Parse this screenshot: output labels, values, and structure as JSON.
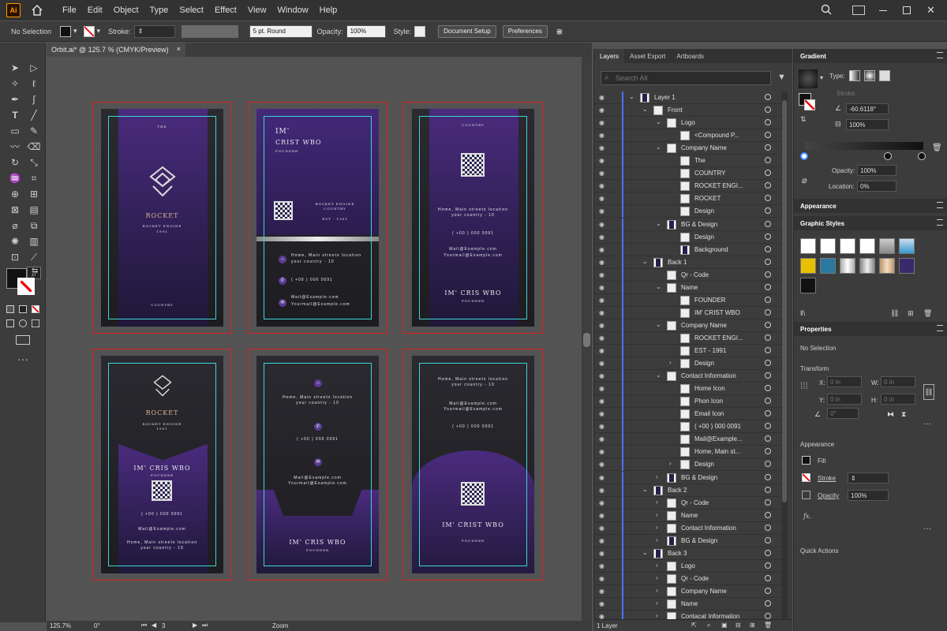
{
  "app": {
    "logo": "Ai",
    "menus": [
      "File",
      "Edit",
      "Object",
      "Type",
      "Select",
      "Effect",
      "View",
      "Window",
      "Help"
    ]
  },
  "control_bar": {
    "selection": "No Selection",
    "stroke_label": "Stroke:",
    "brush": "5 pt. Round",
    "opacity_label": "Opacity:",
    "opacity_value": "100%",
    "style_label": "Style:",
    "document_setup": "Document Setup",
    "preferences": "Preferences"
  },
  "document": {
    "tab_title": "Orbit.ai* @ 125.7 % (CMYK/Preview)",
    "close": "×",
    "zoom": "125.7%",
    "rotation": "0°",
    "artboard_number": "3",
    "status_mode": "Zoom"
  },
  "cards": {
    "c1": {
      "small": "THE",
      "title": "ROCKET",
      "sub": "ROCKET ENGINE",
      "year": "1991",
      "bottom": "COUNTRY"
    },
    "c2": {
      "im": "IM'",
      "name": "CRIST WBO",
      "role": "FOUNDER",
      "company": "ROCKET ENGINE",
      "country": "COUNTRY",
      "est": "EST - 1991",
      "address": "Home, Main streets location",
      "address2": "your country - 10",
      "phone": "( +00 ) 000 0091",
      "mail": "Mail@Example.com",
      "mail2": "Yourmail@Example.com"
    },
    "c3": {
      "top": "COUNTRY",
      "address": "Home, Main streets location",
      "address2": "your country - 10",
      "phone": "( +00 ) 000 0091",
      "mail": "Mail@Example.com",
      "mail2": "Yourmail@Example.com",
      "name": "IM' CRIS WBO",
      "role": "FOUNDER"
    },
    "c4": {
      "title": "ROCKET",
      "sub": "ROCKET ENGINE",
      "year": "1991",
      "name": "IM' CRIS WBO",
      "role": "FOUNDER",
      "phone": "( +00 ) 000 0091",
      "mail": "Mail@Example.com",
      "address": "Home, Main streets location",
      "address2": "your country - 10"
    },
    "c5": {
      "address": "Home, Main streets location",
      "address2": "your country - 10",
      "phone": "( +00 ) 000 0091",
      "mail": "Mail@Example.com",
      "mail2": "Yourmail@Example.com",
      "name": "IM' CRIS WBO",
      "role": "FOUNDER"
    },
    "c6": {
      "address": "Home, Main streets location",
      "address2": "your country - 10",
      "mail": "Mail@Example.com",
      "mail2": "Yourmail@Example.com",
      "phone": "( +00 ) 000 0091",
      "name": "IM' CRIST WBO",
      "role": "FOUNDER"
    }
  },
  "layers_panel": {
    "tabs": [
      "Layers",
      "Asset Export",
      "Artboards"
    ],
    "search_placeholder": "Search All",
    "rows": [
      {
        "name": "Layer 1",
        "depth": 0,
        "expanded": true
      },
      {
        "name": "Front",
        "depth": 1,
        "expanded": true
      },
      {
        "name": "Logo",
        "depth": 2,
        "expanded": true
      },
      {
        "name": "<Compound P...",
        "depth": 3
      },
      {
        "name": "Company Name",
        "depth": 2,
        "expanded": true
      },
      {
        "name": "The",
        "depth": 3
      },
      {
        "name": "COUNTRY",
        "depth": 3
      },
      {
        "name": "ROCKET ENGI...",
        "depth": 3
      },
      {
        "name": "ROCKET",
        "depth": 3
      },
      {
        "name": "Design",
        "depth": 3
      },
      {
        "name": "BG & Design",
        "depth": 2,
        "expanded": true
      },
      {
        "name": "Design",
        "depth": 3
      },
      {
        "name": "Background",
        "depth": 3
      },
      {
        "name": "Back 1",
        "depth": 1,
        "expanded": true
      },
      {
        "name": "Qr - Code",
        "depth": 2
      },
      {
        "name": "Name",
        "depth": 2,
        "expanded": true
      },
      {
        "name": "FOUNDER",
        "depth": 3
      },
      {
        "name": "IM' CRIST WBO",
        "depth": 3
      },
      {
        "name": "Company Name",
        "depth": 2,
        "expanded": true
      },
      {
        "name": "ROCKET ENGI...",
        "depth": 3
      },
      {
        "name": "EST - 1991",
        "depth": 3
      },
      {
        "name": "Design",
        "depth": 3,
        "collapsed": true
      },
      {
        "name": "Contact Information",
        "depth": 2,
        "expanded": true
      },
      {
        "name": "Home Icon",
        "depth": 3
      },
      {
        "name": "Phon Icon",
        "depth": 3
      },
      {
        "name": "Email Icon",
        "depth": 3
      },
      {
        "name": "( +00 ) 000 0091",
        "depth": 3
      },
      {
        "name": "Mail@Example...",
        "depth": 3
      },
      {
        "name": "Home, Main st...",
        "depth": 3
      },
      {
        "name": "Design",
        "depth": 3,
        "collapsed": true
      },
      {
        "name": "BG & Design",
        "depth": 2,
        "collapsed": true
      },
      {
        "name": "Back 2",
        "depth": 1,
        "expanded": true
      },
      {
        "name": "Qr - Code",
        "depth": 2,
        "collapsed": true
      },
      {
        "name": "Name",
        "depth": 2,
        "collapsed": true
      },
      {
        "name": "Contact Information",
        "depth": 2,
        "collapsed": true
      },
      {
        "name": "BG & Design",
        "depth": 2,
        "collapsed": true
      },
      {
        "name": "Back 3",
        "depth": 1,
        "expanded": true
      },
      {
        "name": "Logo",
        "depth": 2,
        "collapsed": true
      },
      {
        "name": "Qr - Code",
        "depth": 2,
        "collapsed": true
      },
      {
        "name": "Company Name",
        "depth": 2,
        "collapsed": true
      },
      {
        "name": "Name",
        "depth": 2,
        "collapsed": true
      },
      {
        "name": "Contacat Information",
        "depth": 2,
        "collapsed": true
      }
    ],
    "footer": "1 Layer"
  },
  "gradient_panel": {
    "title": "Gradient",
    "type_label": "Type:",
    "stroke_label": "Stroke:",
    "angle": "-60.6118°",
    "aspect": "100%",
    "opacity_label": "Opacity:",
    "opacity": "100%",
    "location_label": "Location:",
    "location": "0%"
  },
  "appearance_panel": {
    "title": "Appearance"
  },
  "graphic_styles_panel": {
    "title": "Graphic Styles"
  },
  "properties_panel": {
    "title": "Properties",
    "selection": "No Selection",
    "transform": "Transform",
    "x": "X:",
    "y": "Y:",
    "w": "W:",
    "h": "H:",
    "x_val": "0 in",
    "y_val": "0 in",
    "w_val": "0 in",
    "h_val": "0 in",
    "angle_val": "0°",
    "appearance": "Appearance",
    "fill": "Fill",
    "stroke": "Stroke",
    "opacity": "Opacity",
    "opacity_value": "100%",
    "fx": "fx.",
    "quick_actions": "Quick Actions"
  }
}
